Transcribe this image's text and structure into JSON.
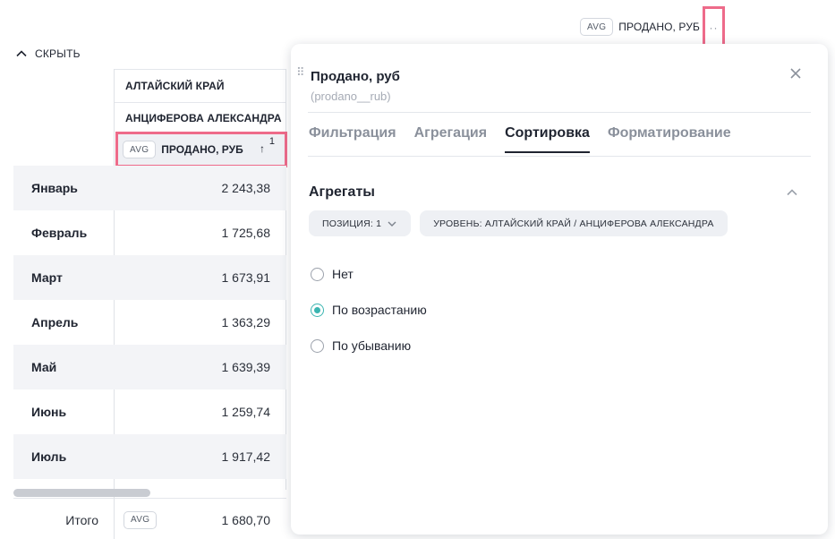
{
  "header": {
    "aggregation_badge": "AVG",
    "measure_label": "ПРОДАНО, РУБ",
    "more_glyph": "··"
  },
  "collapse_label": "СКРЫТЬ",
  "table": {
    "region_header": "АЛТАЙСКИЙ КРАЙ",
    "manager_header": "АНЦИФЕРОВА АЛЕКСАНДРА",
    "measure_badge": "AVG",
    "measure_header": "ПРОДАНО, РУБ",
    "sort_arrow": "↑",
    "sort_position": "1",
    "rows": [
      {
        "month": "Январь",
        "value": "2 243,38"
      },
      {
        "month": "Февраль",
        "value": "1 725,68"
      },
      {
        "month": "Март",
        "value": "1 673,91"
      },
      {
        "month": "Апрель",
        "value": "1 363,29"
      },
      {
        "month": "Май",
        "value": "1 639,39"
      },
      {
        "month": "Июнь",
        "value": "1 259,74"
      },
      {
        "month": "Июль",
        "value": "1 917,42"
      }
    ],
    "total": {
      "label": "Итого",
      "badge": "AVG",
      "value": "1 680,70"
    }
  },
  "panel": {
    "title": "Продано, руб",
    "subtitle": "(prodano__rub)",
    "tabs": [
      {
        "label": "Фильтрация",
        "active": false
      },
      {
        "label": "Агрегация",
        "active": false
      },
      {
        "label": "Сортировка",
        "active": true
      },
      {
        "label": "Форматирование",
        "active": false
      }
    ],
    "section_title": "Агрегаты",
    "position_chip": "ПОЗИЦИЯ: 1",
    "level_chip": "УРОВЕНЬ: АЛТАЙСКИЙ КРАЙ / АНЦИФЕРОВА АЛЕКСАНДРА",
    "sort_options": [
      {
        "label": "Нет",
        "checked": false
      },
      {
        "label": "По возрастанию",
        "checked": true
      },
      {
        "label": "По убыванию",
        "checked": false
      }
    ]
  },
  "colors": {
    "highlight": "#ee6b8a",
    "accent": "#3bb5b1",
    "row_shade": "#f3f4f7"
  }
}
